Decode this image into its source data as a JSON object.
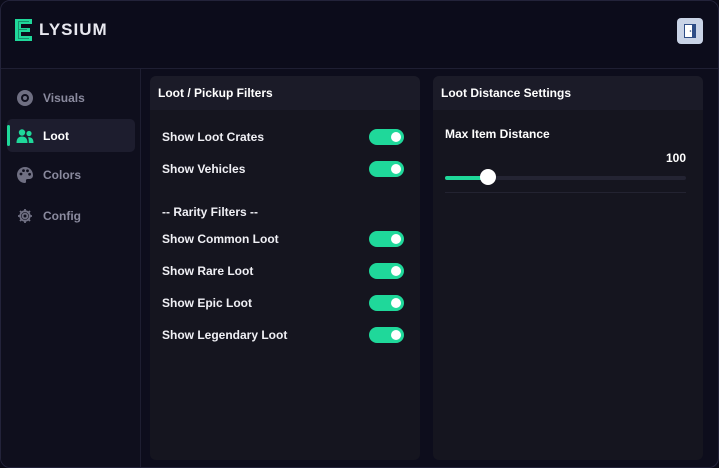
{
  "app": {
    "brand_name": "LYSIUM",
    "brand_letter": "E",
    "accent_color": "#1fd89a"
  },
  "sidebar": {
    "items": [
      {
        "label": "Visuals",
        "icon": "eye-icon",
        "active": false
      },
      {
        "label": "Loot",
        "icon": "users-icon",
        "active": true
      },
      {
        "label": "Colors",
        "icon": "palette-icon",
        "active": false
      },
      {
        "label": "Config",
        "icon": "gear-icon",
        "active": false
      }
    ]
  },
  "loot_panel": {
    "title": "Loot / Pickup Filters",
    "toggles": [
      {
        "label": "Show Loot Crates",
        "on": true
      },
      {
        "label": "Show Vehicles",
        "on": true
      }
    ],
    "rarity_header": "-- Rarity Filters --",
    "rarity_toggles": [
      {
        "label": "Show Common Loot",
        "on": true
      },
      {
        "label": "Show Rare Loot",
        "on": true
      },
      {
        "label": "Show Epic Loot",
        "on": true
      },
      {
        "label": "Show Legendary Loot",
        "on": true
      }
    ]
  },
  "distance_panel": {
    "title": "Loot Distance Settings",
    "slider_label": "Max Item Distance",
    "slider_value": "100",
    "slider_fraction": 0.18
  }
}
